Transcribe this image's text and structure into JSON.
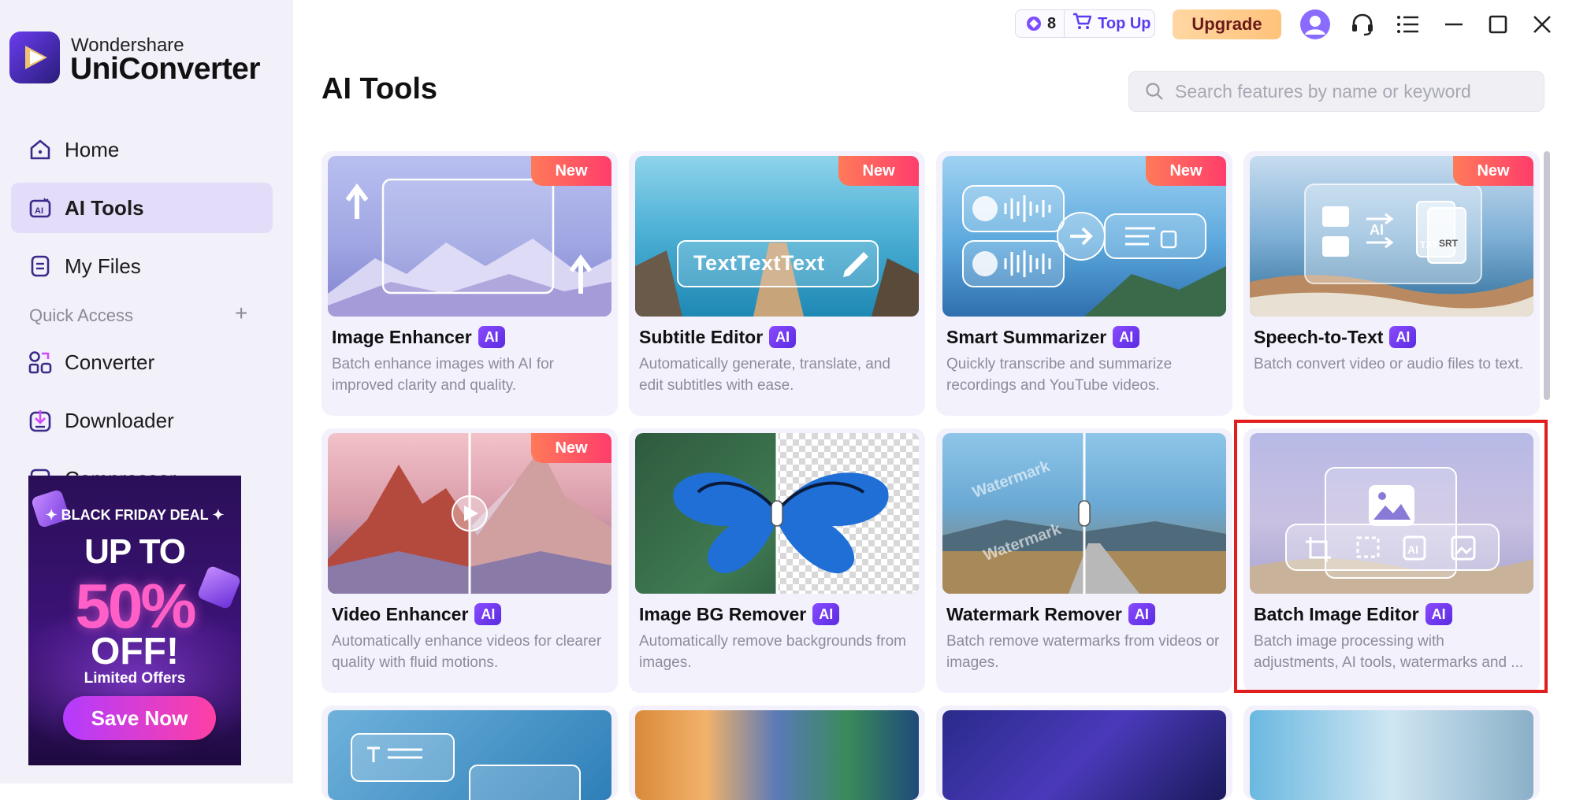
{
  "app": {
    "brand_top": "Wondershare",
    "brand_main": "UniConverter"
  },
  "sidebar": {
    "items": [
      {
        "label": "Home",
        "icon": "home-icon"
      },
      {
        "label": "AI Tools",
        "icon": "ai-tools-icon",
        "active": true
      },
      {
        "label": "My Files",
        "icon": "my-files-icon"
      }
    ],
    "quick_access_label": "Quick Access",
    "quick_items": [
      {
        "label": "Converter",
        "icon": "converter-icon"
      },
      {
        "label": "Downloader",
        "icon": "downloader-icon"
      },
      {
        "label": "Compressor",
        "icon": "compressor-icon"
      }
    ]
  },
  "promo": {
    "deal": "✦ BLACK FRIDAY DEAL ✦",
    "upto": "UP TO",
    "percent": "50%",
    "off": "OFF!",
    "limited": "Limited Offers",
    "button": "Save Now"
  },
  "topbar": {
    "credits": "8",
    "topup": "Top Up",
    "upgrade": "Upgrade"
  },
  "page": {
    "title": "AI Tools",
    "search_placeholder": "Search features by name or keyword"
  },
  "cards": [
    {
      "name": "Image Enhancer",
      "desc": "Batch enhance images with AI for improved clarity and quality.",
      "badge": "New",
      "ai": "AI"
    },
    {
      "name": "Subtitle Editor",
      "desc": "Automatically generate, translate, and edit subtitles with ease.",
      "badge": "New",
      "ai": "AI",
      "thumb_text": "TextTextText"
    },
    {
      "name": "Smart Summarizer",
      "desc": "Quickly transcribe and summarize recordings and YouTube videos.",
      "badge": "New",
      "ai": "AI"
    },
    {
      "name": "Speech-to-Text",
      "desc": "Batch convert video or audio files to text.",
      "badge": "New",
      "ai": "AI",
      "thumb_ai": "AI",
      "thumb_txt": "TXT",
      "thumb_srt": "SRT"
    },
    {
      "name": "Video Enhancer",
      "desc": "Automatically enhance videos for clearer quality with fluid motions.",
      "badge": "New",
      "ai": "AI"
    },
    {
      "name": "Image BG Remover",
      "desc": "Automatically remove backgrounds from images.",
      "ai": "AI"
    },
    {
      "name": "Watermark Remover",
      "desc": "Batch remove watermarks from videos or images.",
      "ai": "AI",
      "wm": "Watermark"
    },
    {
      "name": "Batch Image Editor",
      "desc": "Batch image processing with adjustments, AI tools, watermarks and ...",
      "ai": "AI"
    }
  ],
  "colors": {
    "accent": "#5a3df0",
    "selected": "#e11d1d",
    "badge": "#ff4d66"
  }
}
